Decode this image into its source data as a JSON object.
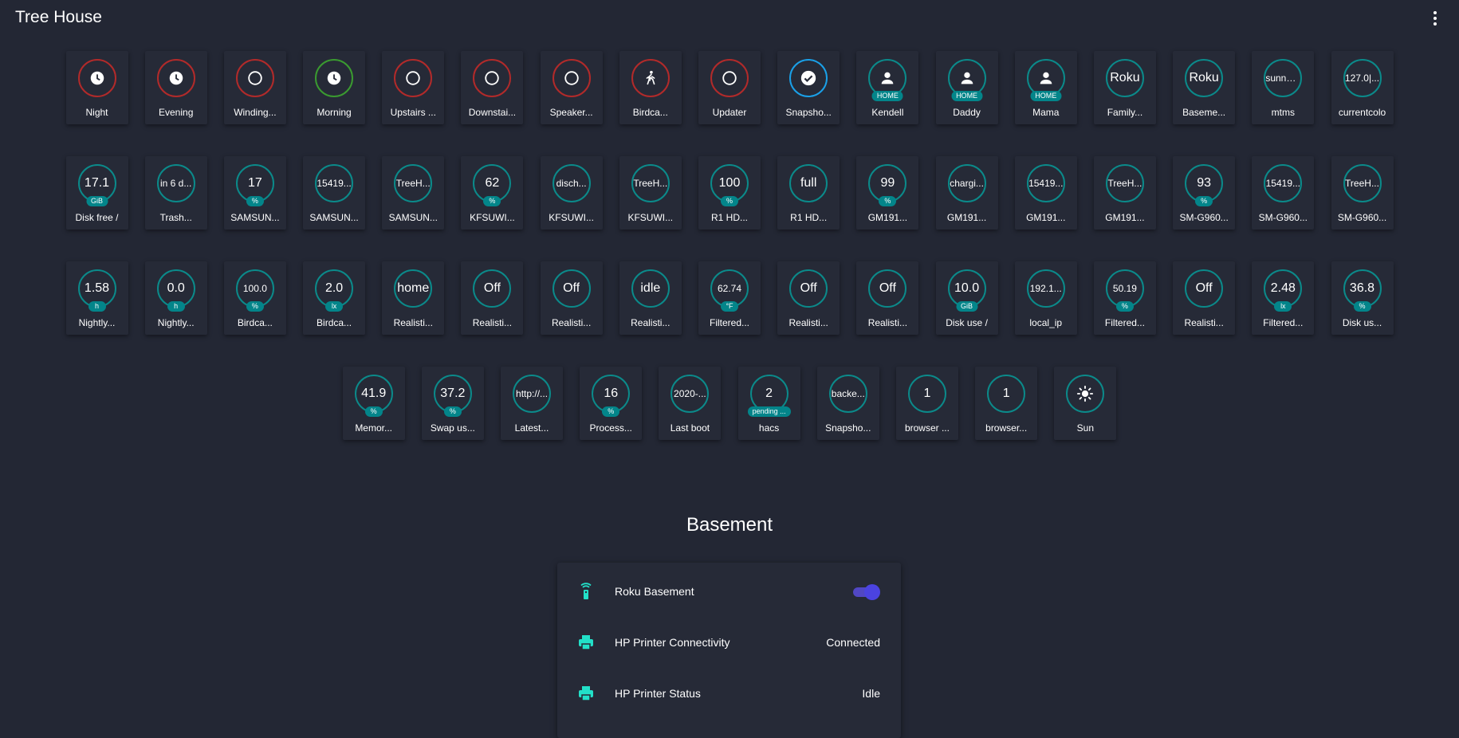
{
  "header": {
    "title": "Tree House",
    "menu_icon": "dots-vertical-icon"
  },
  "badge_rows": [
    [
      {
        "icon": "clock-icon",
        "ring": "red",
        "label": "Night"
      },
      {
        "icon": "clock-icon",
        "ring": "red",
        "label": "Evening"
      },
      {
        "icon": "circle-outline-icon",
        "ring": "red",
        "label": "Winding..."
      },
      {
        "icon": "clock-icon",
        "ring": "green",
        "label": "Morning"
      },
      {
        "icon": "circle-outline-icon",
        "ring": "red",
        "label": "Upstairs ..."
      },
      {
        "icon": "circle-outline-icon",
        "ring": "red",
        "label": "Downstai..."
      },
      {
        "icon": "circle-outline-icon",
        "ring": "red",
        "label": "Speaker..."
      },
      {
        "icon": "walk-icon",
        "ring": "red",
        "label": "Birdca..."
      },
      {
        "icon": "circle-outline-icon",
        "ring": "red",
        "label": "Updater"
      },
      {
        "icon": "check-circle-icon",
        "ring": "blue",
        "label": "Snapsho..."
      },
      {
        "icon": "account-icon",
        "ring": "teal",
        "unit": "HOME",
        "label": "Kendell"
      },
      {
        "icon": "account-icon",
        "ring": "teal",
        "unit": "HOME",
        "label": "Daddy"
      },
      {
        "icon": "account-icon",
        "ring": "teal",
        "unit": "HOME",
        "label": "Mama"
      },
      {
        "value": "Roku",
        "ring": "teal",
        "label": "Family..."
      },
      {
        "value": "Roku",
        "ring": "teal",
        "label": "Baseme..."
      },
      {
        "value": "sunny|...",
        "small": true,
        "ring": "teal",
        "label": "mtms"
      },
      {
        "value": "127.0|...",
        "small": true,
        "ring": "teal",
        "label": "currentcolo"
      }
    ],
    [
      {
        "value": "17.1",
        "ring": "teal",
        "unit": "GiB",
        "label": "Disk free /"
      },
      {
        "value": "in 6 d...",
        "small": true,
        "ring": "teal",
        "label": "Trash..."
      },
      {
        "value": "17",
        "ring": "teal",
        "unit": "%",
        "label": "SAMSUN..."
      },
      {
        "value": "15419...",
        "small": true,
        "ring": "teal",
        "label": "SAMSUN..."
      },
      {
        "value": "TreeH...",
        "small": true,
        "ring": "teal",
        "label": "SAMSUN..."
      },
      {
        "value": "62",
        "ring": "teal",
        "unit": "%",
        "label": "KFSUWI..."
      },
      {
        "value": "disch...",
        "small": true,
        "ring": "teal",
        "label": "KFSUWI..."
      },
      {
        "value": "TreeH...",
        "small": true,
        "ring": "teal",
        "label": "KFSUWI..."
      },
      {
        "value": "100",
        "ring": "teal",
        "unit": "%",
        "label": "R1 HD..."
      },
      {
        "value": "full",
        "ring": "teal",
        "label": "R1 HD..."
      },
      {
        "value": "99",
        "ring": "teal",
        "unit": "%",
        "label": "GM191..."
      },
      {
        "value": "chargi...",
        "small": true,
        "ring": "teal",
        "label": "GM191..."
      },
      {
        "value": "15419...",
        "small": true,
        "ring": "teal",
        "label": "GM191..."
      },
      {
        "value": "TreeH...",
        "small": true,
        "ring": "teal",
        "label": "GM191..."
      },
      {
        "value": "93",
        "ring": "teal",
        "unit": "%",
        "label": "SM-G960..."
      },
      {
        "value": "15419...",
        "small": true,
        "ring": "teal",
        "label": "SM-G960..."
      },
      {
        "value": "TreeH...",
        "small": true,
        "ring": "teal",
        "label": "SM-G960..."
      }
    ],
    [
      {
        "value": "1.58",
        "ring": "teal",
        "unit": "h",
        "label": "Nightly..."
      },
      {
        "value": "0.0",
        "ring": "teal",
        "unit": "h",
        "label": "Nightly..."
      },
      {
        "value": "100.0",
        "small": true,
        "ring": "teal",
        "unit": "%",
        "label": "Birdca..."
      },
      {
        "value": "2.0",
        "ring": "teal",
        "unit": "lx",
        "label": "Birdca..."
      },
      {
        "value": "home",
        "ring": "teal",
        "label": "Realisti..."
      },
      {
        "value": "Off",
        "ring": "teal",
        "label": "Realisti..."
      },
      {
        "value": "Off",
        "ring": "teal",
        "label": "Realisti..."
      },
      {
        "value": "idle",
        "ring": "teal",
        "label": "Realisti..."
      },
      {
        "value": "62.74",
        "small": true,
        "ring": "teal",
        "unit": "°F",
        "label": "Filtered..."
      },
      {
        "value": "Off",
        "ring": "teal",
        "label": "Realisti..."
      },
      {
        "value": "Off",
        "ring": "teal",
        "label": "Realisti..."
      },
      {
        "value": "10.0",
        "ring": "teal",
        "unit": "GiB",
        "label": "Disk use /"
      },
      {
        "value": "192.1...",
        "small": true,
        "ring": "teal",
        "label": "local_ip"
      },
      {
        "value": "50.19",
        "small": true,
        "ring": "teal",
        "unit": "%",
        "label": "Filtered..."
      },
      {
        "value": "Off",
        "ring": "teal",
        "label": "Realisti..."
      },
      {
        "value": "2.48",
        "ring": "teal",
        "unit": "lx",
        "label": "Filtered..."
      },
      {
        "value": "36.8",
        "ring": "teal",
        "unit": "%",
        "label": "Disk us..."
      }
    ],
    [
      {
        "value": "41.9",
        "ring": "teal",
        "unit": "%",
        "label": "Memor..."
      },
      {
        "value": "37.2",
        "ring": "teal",
        "unit": "%",
        "label": "Swap us..."
      },
      {
        "value": "http://...",
        "small": true,
        "ring": "teal",
        "label": "Latest..."
      },
      {
        "value": "16",
        "ring": "teal",
        "unit": "%",
        "label": "Process..."
      },
      {
        "value": "2020-...",
        "small": true,
        "ring": "teal",
        "label": "Last boot"
      },
      {
        "value": "2",
        "ring": "teal",
        "unit": "pending ...",
        "label": "hacs"
      },
      {
        "value": "backe...",
        "small": true,
        "ring": "teal",
        "label": "Snapsho..."
      },
      {
        "value": "1",
        "ring": "teal",
        "label": "browser ..."
      },
      {
        "value": "1",
        "ring": "teal",
        "label": "browser..."
      },
      {
        "icon": "sun-icon",
        "ring": "teal",
        "label": "Sun"
      }
    ]
  ],
  "section": {
    "title": "Basement"
  },
  "entities": [
    {
      "icon": "remote-icon",
      "name": "Roku Basement",
      "type": "toggle",
      "on": true
    },
    {
      "icon": "printer-icon",
      "name": "HP Printer Connectivity",
      "type": "state",
      "state": "Connected"
    },
    {
      "icon": "printer-icon",
      "name": "HP Printer Status",
      "type": "state",
      "state": "Idle"
    }
  ],
  "colors": {
    "background": "#232734",
    "teal": "#0b8a8a",
    "red": "#b22a2a",
    "green": "#3a9a30",
    "blue": "#1aa0e8",
    "entity_icon": "#22e0c8",
    "toggle": "#4b43e0"
  }
}
